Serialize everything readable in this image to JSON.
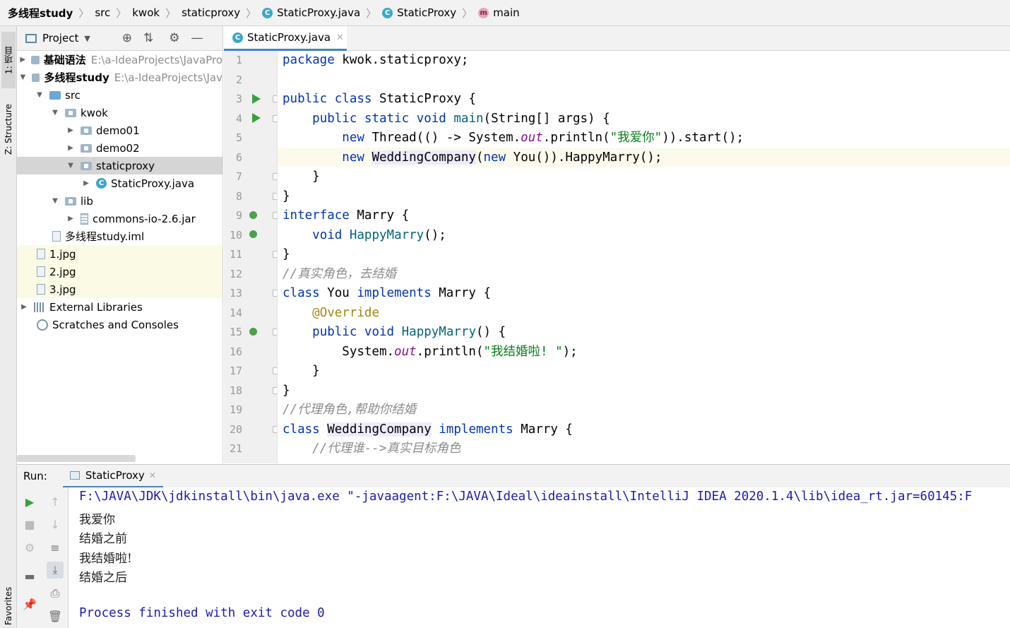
{
  "breadcrumb": {
    "project": "多线程study",
    "items": [
      "src",
      "kwok",
      "staticproxy",
      "StaticProxy.java",
      "StaticProxy",
      "main"
    ]
  },
  "left_strip": {
    "project_tab": "1: 项目",
    "structure_tab": "Z: Structure",
    "favorites_tab": "Favorites"
  },
  "project_panel": {
    "title": "Project",
    "tree": [
      {
        "name": "基础语法",
        "path": "E:\\a-IdeaProjects\\JavaPro"
      },
      {
        "name": "多线程study",
        "path": "E:\\a-IdeaProjects\\Jav"
      },
      {
        "name": "src"
      },
      {
        "name": "kwok"
      },
      {
        "name": "demo01"
      },
      {
        "name": "demo02"
      },
      {
        "name": "staticproxy"
      },
      {
        "name": "StaticProxy.java"
      },
      {
        "name": "lib"
      },
      {
        "name": "commons-io-2.6.jar"
      },
      {
        "name": "多线程study.iml"
      },
      {
        "name": "1.jpg"
      },
      {
        "name": "2.jpg"
      },
      {
        "name": "3.jpg"
      },
      {
        "name": "External Libraries"
      },
      {
        "name": "Scratches and Consoles"
      }
    ]
  },
  "editor": {
    "tab_label": "StaticProxy.java",
    "line_numbers": [
      "1",
      "2",
      "3",
      "4",
      "5",
      "6",
      "7",
      "8",
      "9",
      "10",
      "11",
      "12",
      "13",
      "14",
      "15",
      "16",
      "17",
      "18",
      "19",
      "20",
      "21"
    ],
    "lines": [
      "package kwok.staticproxy;",
      "",
      "public class StaticProxy {",
      "    public static void main(String[] args) {",
      "        new Thread(() -> System.out.println(\"我爱你\")).start();",
      "        new WeddingCompany(new You()).HappyMarry();",
      "    }",
      "}",
      "interface Marry {",
      "    void HappyMarry();",
      "}",
      "//真实角色，去结婚",
      "class You implements Marry {",
      "    @Override",
      "    public void HappyMarry() {",
      "        System.out.println(\"我结婚啦! \");",
      "    }",
      "}",
      "//代理角色,帮助你结婚",
      "class WeddingCompany implements Marry {",
      "    //代理谁-->真实目标角色"
    ]
  },
  "run_panel": {
    "label": "Run:",
    "tab_label": "StaticProxy",
    "console": {
      "command": "F:\\JAVA\\JDK\\jdkinstall\\bin\\java.exe \"-javaagent:F:\\JAVA\\Ideal\\ideainstall\\IntelliJ IDEA 2020.1.4\\lib\\idea_rt.jar=60145:F",
      "output": [
        "我爱你",
        "结婚之前",
        "我结婚啦!",
        "结婚之后"
      ],
      "exit": "Process finished with exit code 0"
    }
  }
}
